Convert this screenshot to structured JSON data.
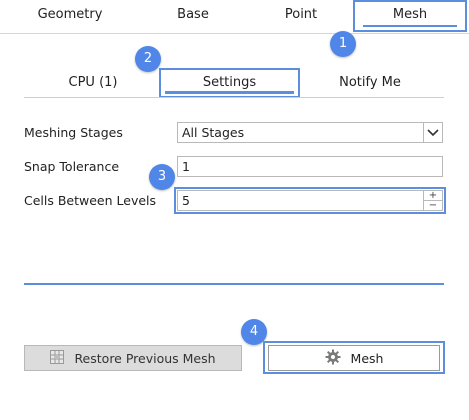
{
  "top_tabs": [
    {
      "label": "Geometry"
    },
    {
      "label": "Base"
    },
    {
      "label": "Point"
    },
    {
      "label": "Mesh",
      "active": true
    }
  ],
  "sub_tabs": [
    {
      "label": "CPU  (1)"
    },
    {
      "label": "Settings",
      "active": true
    },
    {
      "label": "Notify Me"
    }
  ],
  "form": {
    "meshing_stages": {
      "label": "Meshing Stages",
      "value": "All Stages"
    },
    "snap_tolerance": {
      "label": "Snap Tolerance",
      "value": "1"
    },
    "cells_between_levels": {
      "label": "Cells Between Levels",
      "value": "5"
    }
  },
  "stepper": {
    "up": "+",
    "down": "−"
  },
  "buttons": {
    "restore": {
      "label": "Restore Previous Mesh",
      "icon": "grid-icon"
    },
    "mesh": {
      "label": "Mesh",
      "icon": "gear-icon"
    }
  },
  "callouts": [
    "1",
    "2",
    "3",
    "4"
  ],
  "colors": {
    "accent": "#5b8edc",
    "callout": "#4f86e8"
  }
}
